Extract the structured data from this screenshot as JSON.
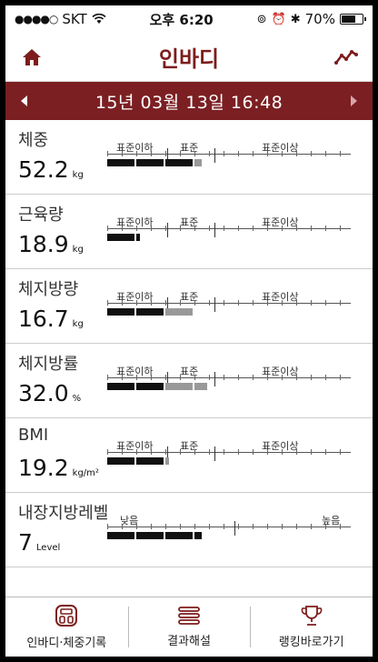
{
  "status_bar": {
    "carrier": "SKT",
    "time": "오후 6:20",
    "battery": "70%",
    "battery_level": 0.7
  },
  "nav": {
    "title": "인바디",
    "left_icon": "home-icon",
    "right_icon": "trend-chart-icon"
  },
  "date_bar": {
    "date": "15년 03월 13일 16:48",
    "prev_icon": "triangle-left-icon",
    "next_icon": "triangle-right-icon"
  },
  "labels3": [
    "표준이하",
    "표준",
    "표준이상"
  ],
  "labels2": [
    "낮음",
    "높음"
  ],
  "metrics": [
    {
      "name": "체중",
      "value": "52.2",
      "unit": "kg",
      "scale": 3,
      "bar": [
        3,
        0.3
      ]
    },
    {
      "name": "근육량",
      "value": "18.9",
      "unit": "kg",
      "scale": 3,
      "bar": [
        1.1,
        0
      ]
    },
    {
      "name": "체지방량",
      "value": "16.7",
      "unit": "kg",
      "scale": 3,
      "bar": [
        2,
        1
      ]
    },
    {
      "name": "체지방률",
      "value": "32.0",
      "unit": "%",
      "scale": 3,
      "bar": [
        2,
        1.5
      ]
    },
    {
      "name": "BMI",
      "value": "19.2",
      "unit": "kg/m²",
      "scale": 3,
      "bar": [
        2,
        0.1
      ]
    },
    {
      "name": "내장지방레벨",
      "value": "7",
      "unit": "Level",
      "scale": 2,
      "bar": [
        3.3,
        0
      ]
    }
  ],
  "tabs": [
    {
      "label": "인바디·체중기록",
      "icon": "scale-device-icon"
    },
    {
      "label": "결과해설",
      "icon": "stacked-lines-icon"
    },
    {
      "label": "랭킹바로가기",
      "icon": "trophy-icon"
    }
  ],
  "colors": {
    "accent": "#7b1f22",
    "bar_black": "#111111",
    "bar_gray": "#999999"
  }
}
